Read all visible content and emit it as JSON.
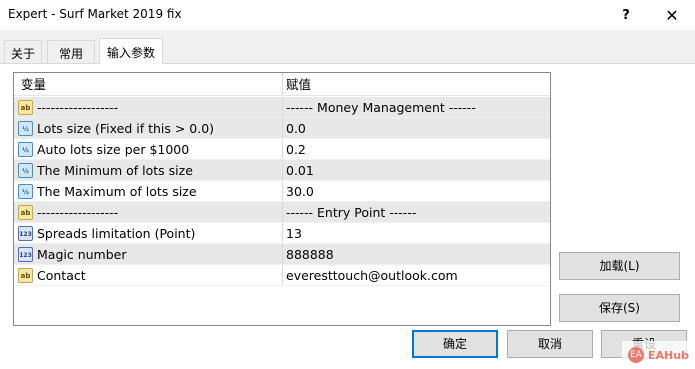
{
  "window": {
    "title": "Expert - Surf Market 2019 fix",
    "help_glyph": "?",
    "close_glyph": "✕"
  },
  "tabs": [
    {
      "label": "关于"
    },
    {
      "label": "常用"
    },
    {
      "label": "输入参数",
      "active": true
    }
  ],
  "grid": {
    "headers": {
      "variable": "变量",
      "value": "赋值"
    },
    "rows": [
      {
        "icon": "ab",
        "icon_text": "ab",
        "name": "------------------",
        "value": "------ Money Management ------"
      },
      {
        "icon": "fraction",
        "icon_text": "½",
        "name": "Lots size (Fixed if this > 0.0)",
        "value": "0.0"
      },
      {
        "icon": "fraction",
        "icon_text": "½",
        "name": "Auto lots size per $1000",
        "value": "0.2"
      },
      {
        "icon": "fraction",
        "icon_text": "½",
        "name": "The Minimum of lots size",
        "value": "0.01"
      },
      {
        "icon": "fraction",
        "icon_text": "½",
        "name": "The Maximum of lots size",
        "value": "30.0"
      },
      {
        "icon": "ab",
        "icon_text": "ab",
        "name": "------------------",
        "value": "------ Entry Point ------"
      },
      {
        "icon": "integer",
        "icon_text": "123",
        "name": "Spreads limitation (Point)",
        "value": "13"
      },
      {
        "icon": "integer",
        "icon_text": "123",
        "name": "Magic number",
        "value": "888888"
      },
      {
        "icon": "ab",
        "icon_text": "ab",
        "name": "Contact",
        "value": "everesttouch@outlook.com"
      }
    ]
  },
  "buttons": {
    "load": "加载(L)",
    "save": "保存(S)",
    "ok": "确定",
    "cancel": "取消",
    "reset": "重设"
  },
  "watermark": {
    "logo_text": "EA",
    "text": "EAHub"
  },
  "colors": {
    "accent": "#0078d7",
    "alt_row": "#e8e8e8"
  }
}
